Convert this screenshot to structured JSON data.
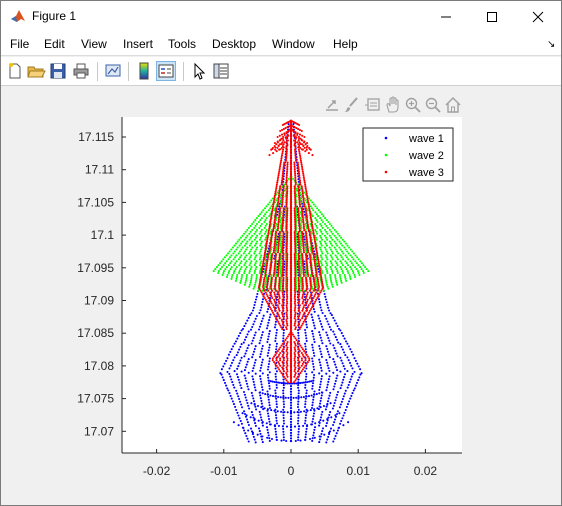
{
  "window": {
    "title": "Figure 1"
  },
  "menu": {
    "items": [
      "File",
      "Edit",
      "View",
      "Insert",
      "Tools",
      "Desktop",
      "Window",
      "Help"
    ]
  },
  "toolbar": {
    "buttons": [
      "new-figure-icon",
      "open-icon",
      "save-icon",
      "print-icon",
      "link-plot-icon",
      "colorbar-icon",
      "legend-icon",
      "pointer-icon",
      "property-inspector-icon"
    ]
  },
  "axes_toolbar": {
    "buttons": [
      "export-icon",
      "brush-icon",
      "data-tips-icon",
      "pan-icon",
      "zoom-in-icon",
      "zoom-out-icon",
      "home-icon"
    ]
  },
  "colors": {
    "wave1": "#0000ff",
    "wave2": "#00ff00",
    "wave3": "#ff0000",
    "axes_bg": "#ffffff",
    "figure_bg": "#f0f0f0"
  },
  "chart_data": {
    "type": "scatter",
    "title": "",
    "xlabel": "",
    "ylabel": "",
    "xlim": [
      -0.026,
      0.026
    ],
    "ylim": [
      17.066,
      17.1175
    ],
    "xticks": [
      -0.02,
      -0.01,
      0,
      0.01,
      0.02
    ],
    "xtick_labels": [
      "-0.02",
      "-0.01",
      "0",
      "0.01",
      "0.02"
    ],
    "yticks": [
      17.07,
      17.075,
      17.08,
      17.085,
      17.09,
      17.095,
      17.1,
      17.105,
      17.11,
      17.115
    ],
    "ytick_labels": [
      "17.07",
      "17.075",
      "17.08",
      "17.085",
      "17.09",
      "17.095",
      "17.1",
      "17.105",
      "17.11",
      "17.115"
    ],
    "grid": false,
    "legend_location": "top-right",
    "series": [
      {
        "name": "wave 1",
        "marker": ".",
        "description_points": [
          {
            "x": 0,
            "y": 17.1165
          },
          {
            "x": 0.0002,
            "y": 17.114
          },
          {
            "x": 0.0005,
            "y": 17.11
          },
          {
            "x": 0.001,
            "y": 17.106
          },
          {
            "x": -0.001,
            "y": 17.106
          },
          {
            "x": 0.0055,
            "y": 17.089
          },
          {
            "x": -0.0055,
            "y": 17.089
          },
          {
            "x": 0.0105,
            "y": 17.079
          },
          {
            "x": -0.0105,
            "y": 17.079
          },
          {
            "x": 0.0085,
            "y": 17.072
          },
          {
            "x": -0.0085,
            "y": 17.072
          },
          {
            "x": 0,
            "y": 17.0685
          }
        ]
      },
      {
        "name": "wave 2",
        "marker": ".",
        "description_points": [
          {
            "x": 0,
            "y": 17.109
          },
          {
            "x": 0.0115,
            "y": 17.0945
          },
          {
            "x": -0.0115,
            "y": 17.0945
          },
          {
            "x": 0.005,
            "y": 17.092
          },
          {
            "x": -0.005,
            "y": 17.092
          },
          {
            "x": 0,
            "y": 17.0915
          }
        ]
      },
      {
        "name": "wave 3",
        "marker": ".",
        "description_points": [
          {
            "x": 0,
            "y": 17.1175
          },
          {
            "x": 0.003,
            "y": 17.114
          },
          {
            "x": -0.003,
            "y": 17.114
          },
          {
            "x": 0.0048,
            "y": 17.092
          },
          {
            "x": -0.0048,
            "y": 17.092
          },
          {
            "x": 0,
            "y": 17.085
          },
          {
            "x": 0.003,
            "y": 17.081
          },
          {
            "x": -0.003,
            "y": 17.081
          },
          {
            "x": 0,
            "y": 17.0775
          }
        ]
      }
    ]
  }
}
